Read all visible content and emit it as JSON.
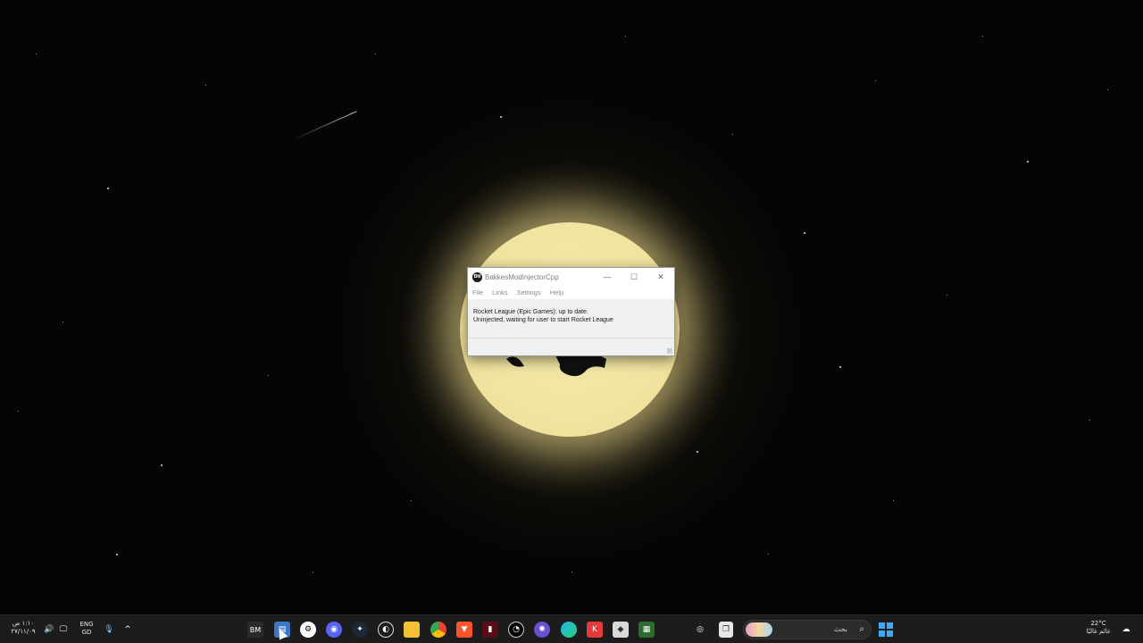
{
  "window": {
    "title": "BakkesModInjectorCpp",
    "icon_text": "BM",
    "controls": {
      "minimize": "—",
      "maximize": "☐",
      "close": "✕"
    },
    "menu": [
      "File",
      "Links",
      "Settings",
      "Help"
    ],
    "status_lines": [
      "Rocket League (Epic Games): up to date.",
      "Uninjected, waiting for user to start Rocket League"
    ]
  },
  "taskbar": {
    "clock": {
      "time": "١:١٠ ص",
      "date": "٢٧/١١/٠٩"
    },
    "language": {
      "top": "ENG",
      "bottom": "GD"
    },
    "search_placeholder": "بحث",
    "weather": {
      "temp": "22°C",
      "label": "غائم غالبًا"
    },
    "pinned_icons": [
      "bakkesmod-icon",
      "task-manager-icon",
      "settings-icon",
      "discord-icon",
      "steam-icon",
      "epic-icon",
      "file-explorer-icon",
      "chrome-icon",
      "brave-icon",
      "app-icon",
      "obs-icon",
      "app-icon-2",
      "edge-icon",
      "app-icon-3",
      "app-icon-4",
      "app-icon-5"
    ],
    "colors": {
      "background": "#1c1c1c",
      "accent": "#3fa9f5"
    }
  }
}
